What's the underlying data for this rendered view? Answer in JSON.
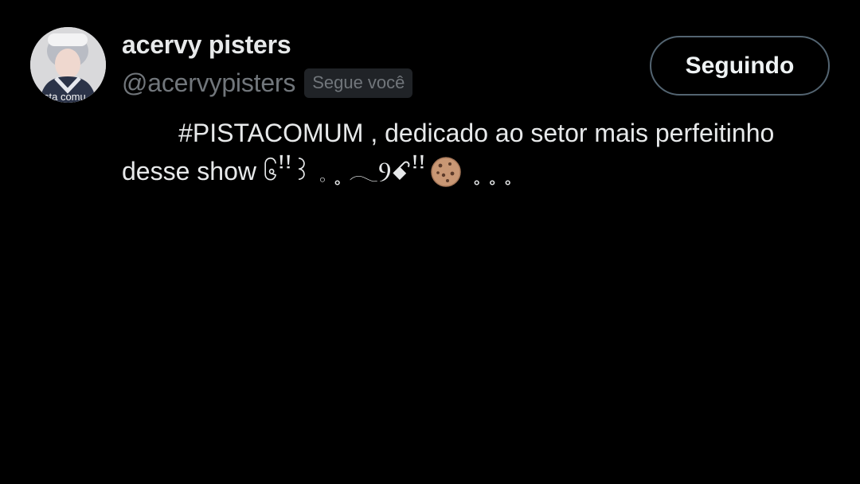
{
  "author": {
    "display_name": "acervy pisters",
    "handle": "@acervypisters",
    "follows_you_badge": "Segue você",
    "avatar_caption": "sta comu"
  },
  "follow_button": {
    "label": "Seguindo"
  },
  "post": {
    "text_before_icon": "        #PISTACOMUM , dedicado ao setor mais perfeitinho desse show ၆ꜝꜝ꒱ 𓈒 ˳ 𓂃Ⳋꗃꜝꜝ",
    "icon": "cookie-icon",
    "text_after_icon": " ˳ ˳ ˳"
  },
  "colors": {
    "background": "#000000",
    "primary_text": "#e7e9ea",
    "secondary_text": "#71767b",
    "badge_background": "#202327",
    "button_border": "#536471"
  }
}
